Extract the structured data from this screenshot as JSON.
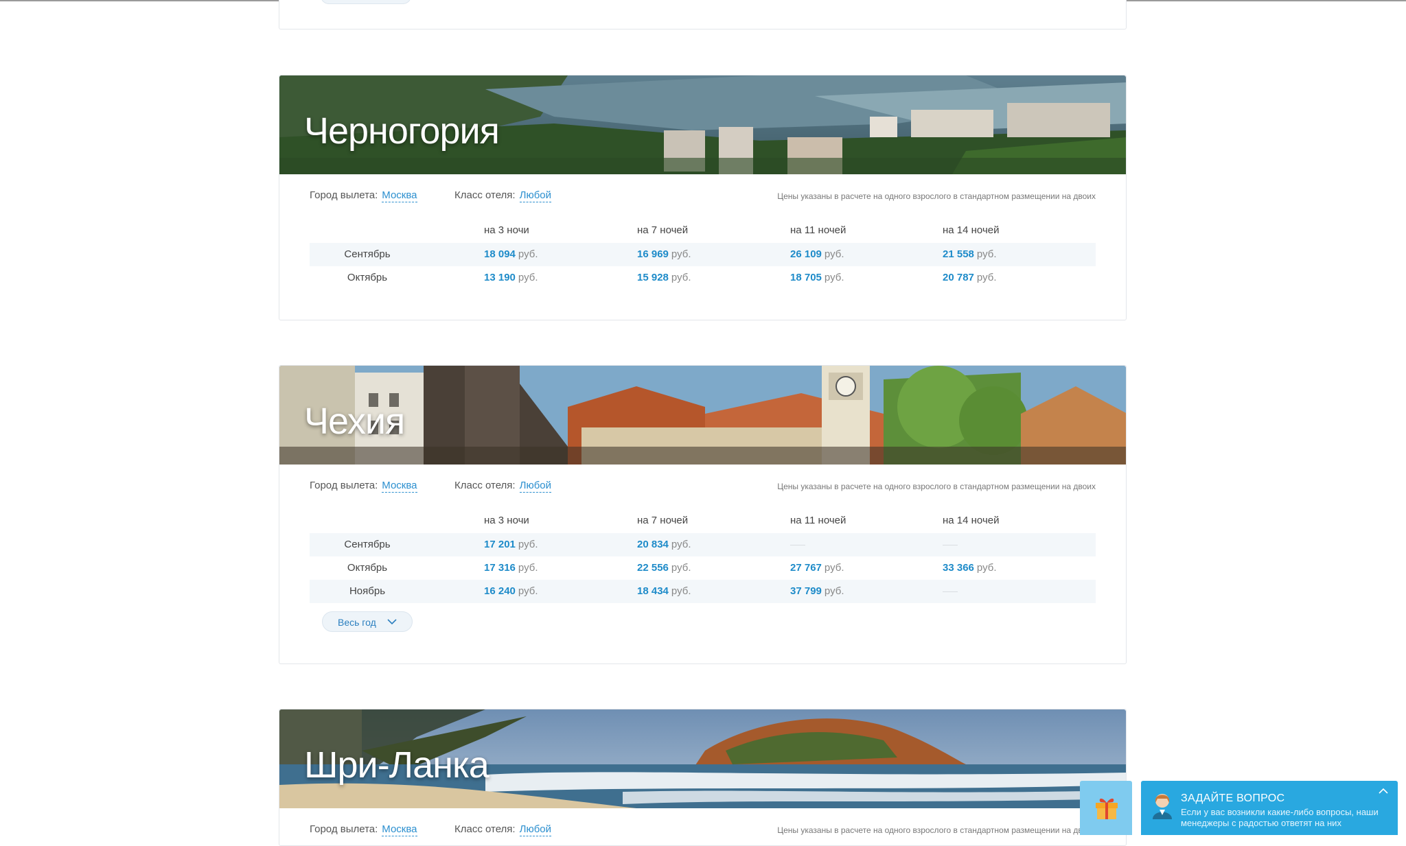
{
  "labels": {
    "city": "Город вылета:",
    "hotel": "Класс отеля:",
    "note": "Цены указаны в расчете на одного взрослого в стандартном размещении на двоих",
    "currency": "руб.",
    "nights": [
      "на 3 ночи",
      "на 7 ночей",
      "на 11 ночей",
      "на 14 ночей"
    ],
    "year_button": "Весь год"
  },
  "countries": [
    {
      "name": "Черногория",
      "city": "Москва",
      "hotel": "Любой",
      "rows": [
        {
          "month": "Сентябрь",
          "prices": [
            "18 094",
            "16 969",
            "26 109",
            "21 558"
          ]
        },
        {
          "month": "Октябрь",
          "prices": [
            "13 190",
            "15 928",
            "18 705",
            "20 787"
          ]
        }
      ]
    },
    {
      "name": "Чехия",
      "city": "Москва",
      "hotel": "Любой",
      "rows": [
        {
          "month": "Сентябрь",
          "prices": [
            "17 201",
            "20 834",
            null,
            null
          ]
        },
        {
          "month": "Октябрь",
          "prices": [
            "17 316",
            "22 556",
            "27 767",
            "33 366"
          ]
        },
        {
          "month": "Ноябрь",
          "prices": [
            "16 240",
            "18 434",
            "37 799",
            null
          ]
        }
      ]
    },
    {
      "name": "Шри-Ланка",
      "city": "Москва",
      "hotel": "Любой",
      "rows": []
    }
  ],
  "chat": {
    "title": "ЗАДАЙТЕ ВОПРОС",
    "message": "Если у вас возникли какие-либо вопросы, наши менеджеры с радостью ответят на них"
  },
  "colors": {
    "accent": "#1e8bc9",
    "chat_bg": "#29a8e0",
    "gift_bg": "#7fcbef"
  }
}
